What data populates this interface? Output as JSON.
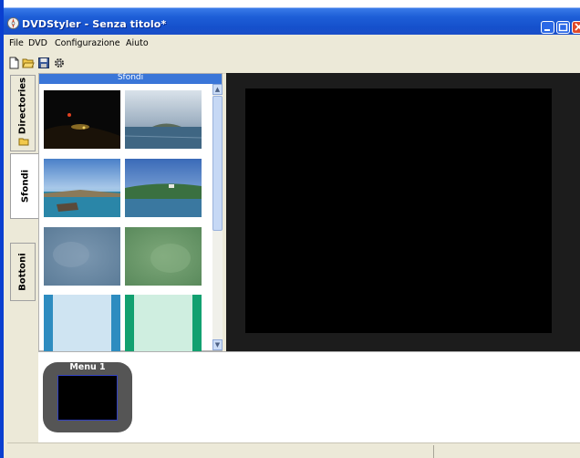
{
  "window": {
    "title": "DVDStyler - Senza titolo*"
  },
  "menubar": {
    "items": [
      "File",
      "DVD",
      "Configurazione",
      "Aiuto"
    ]
  },
  "toolbar": {
    "icons": [
      "new-file-icon",
      "open-folder-icon",
      "save-icon",
      "settings-icon"
    ]
  },
  "side_tabs": [
    {
      "label": "Directories",
      "icon": "folder-icon"
    },
    {
      "label": "Sfondi",
      "active": true
    },
    {
      "label": "Bottoni"
    }
  ],
  "panel": {
    "header": "Sfondi"
  },
  "menus": [
    {
      "label": "Menu 1"
    }
  ],
  "colors": {
    "accent": "#3a76d8",
    "titlebar": "#1e5fd8"
  }
}
